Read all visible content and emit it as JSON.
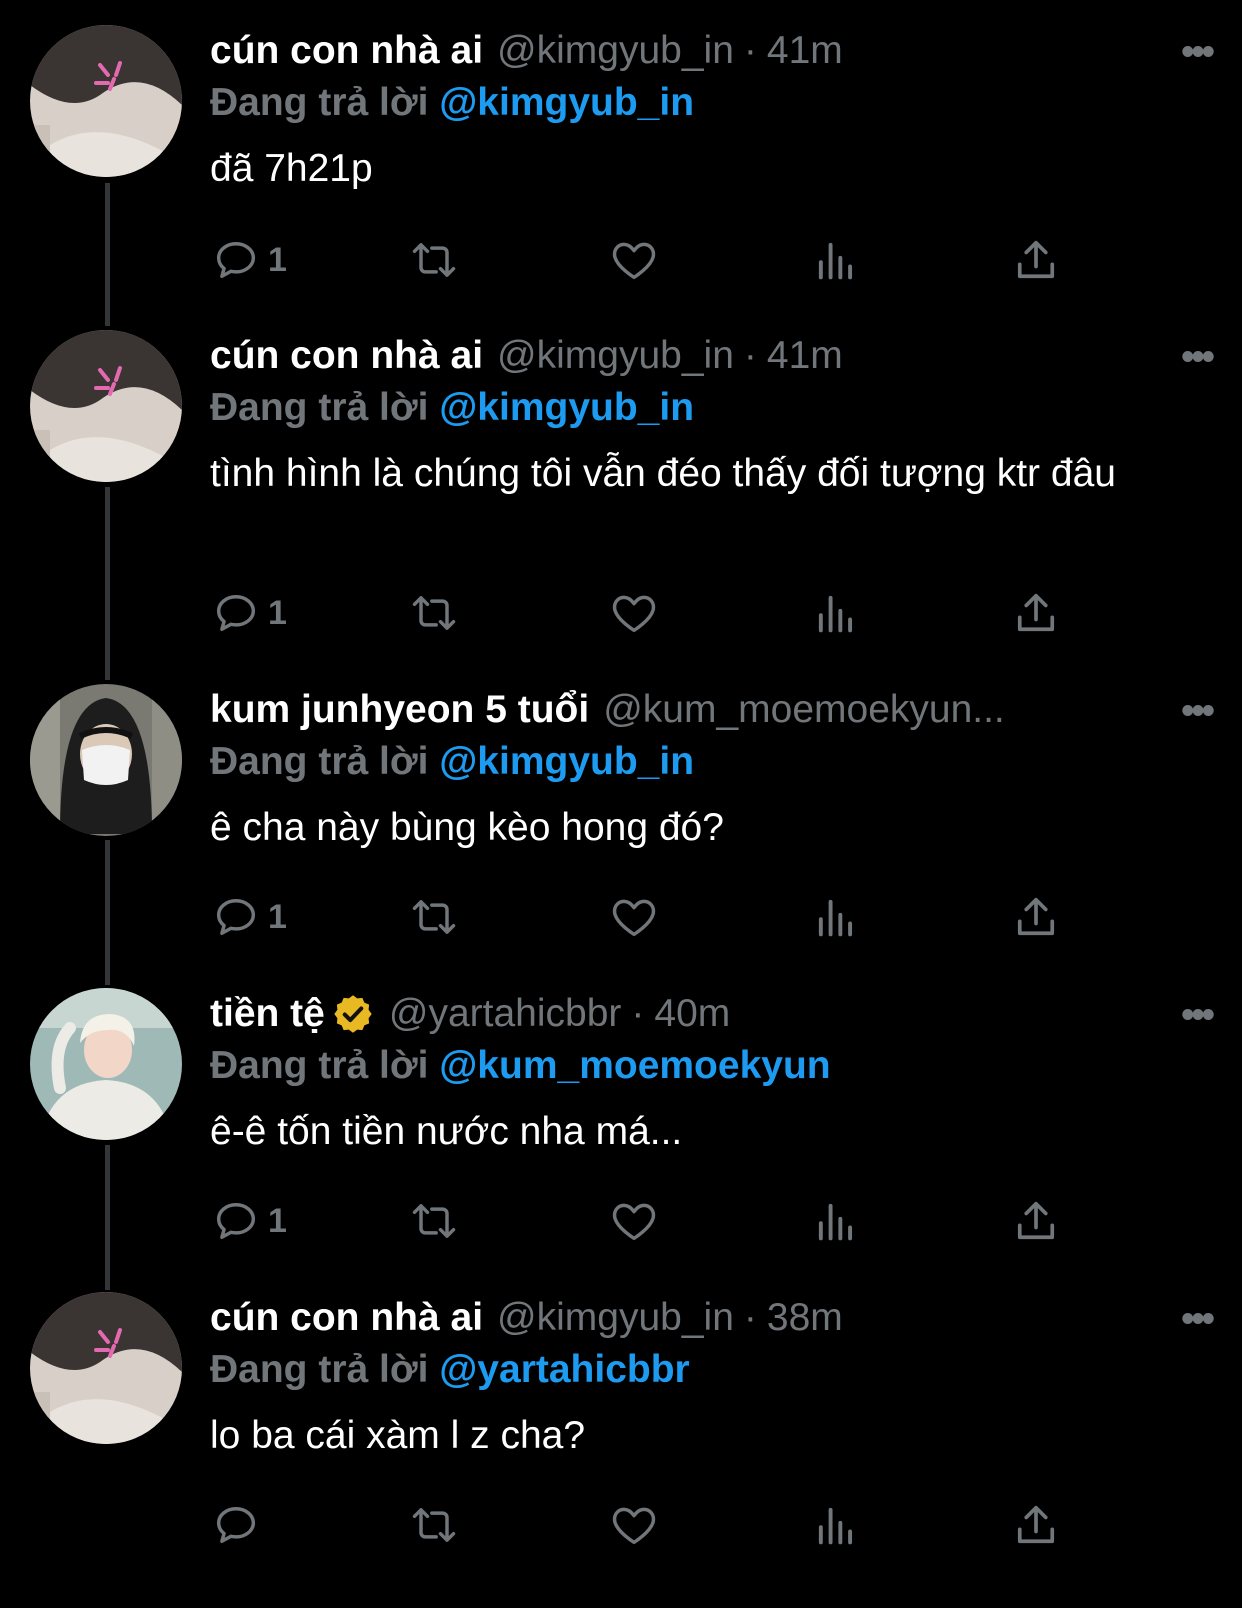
{
  "tweets": [
    {
      "name": "cún con nhà ai",
      "handle": "@kimgyub_in",
      "time": "41m",
      "reply_prefix": "Đang trả lời",
      "reply_to": "@kimgyub_in",
      "text": "đã 7h21p",
      "reply_count": "1",
      "avatar": "pink-hair-avatar"
    },
    {
      "name": "cún con nhà ai",
      "handle": "@kimgyub_in",
      "time": "41m",
      "reply_prefix": "Đang trả lời",
      "reply_to": "@kimgyub_in",
      "text": "tình hình là chúng tôi vẫn đéo thấy đối tượng ktr đâu",
      "reply_count": "1",
      "avatar": "pink-hair-avatar"
    },
    {
      "name": "kum junhyeon 5 tuổi",
      "handle": "@kum_moemoekyun...",
      "time": "",
      "reply_prefix": "Đang trả lời",
      "reply_to": "@kimgyub_in",
      "text": "ê cha này bùng kèo hong đó?",
      "reply_count": "1",
      "avatar": "masked-hood-avatar"
    },
    {
      "name": "tiền tệ",
      "handle": "@yartahicbbr",
      "time": "40m",
      "reply_prefix": "Đang trả lời",
      "reply_to": "@kum_moemoekyun",
      "text": "ê-ê tốn tiền nước nha má...",
      "reply_count": "1",
      "avatar": "blond-sweater-avatar",
      "verified": true
    },
    {
      "name": "cún con nhà ai",
      "handle": "@kimgyub_in",
      "time": "38m",
      "reply_prefix": "Đang trả lời",
      "reply_to": "@yartahicbbr",
      "text": "lo ba cái xàm l z cha?",
      "reply_count": "",
      "avatar": "pink-hair-avatar"
    }
  ],
  "dot": "·",
  "more_label": "•••",
  "colors": {
    "background": "#000000",
    "accent": "#1d9bf0",
    "muted": "#71767b",
    "text": "#ffffff",
    "verified": "#e8b923"
  },
  "icons": [
    "reply-icon",
    "retweet-icon",
    "like-icon",
    "views-icon",
    "share-icon",
    "verified-badge-icon",
    "more-icon"
  ]
}
